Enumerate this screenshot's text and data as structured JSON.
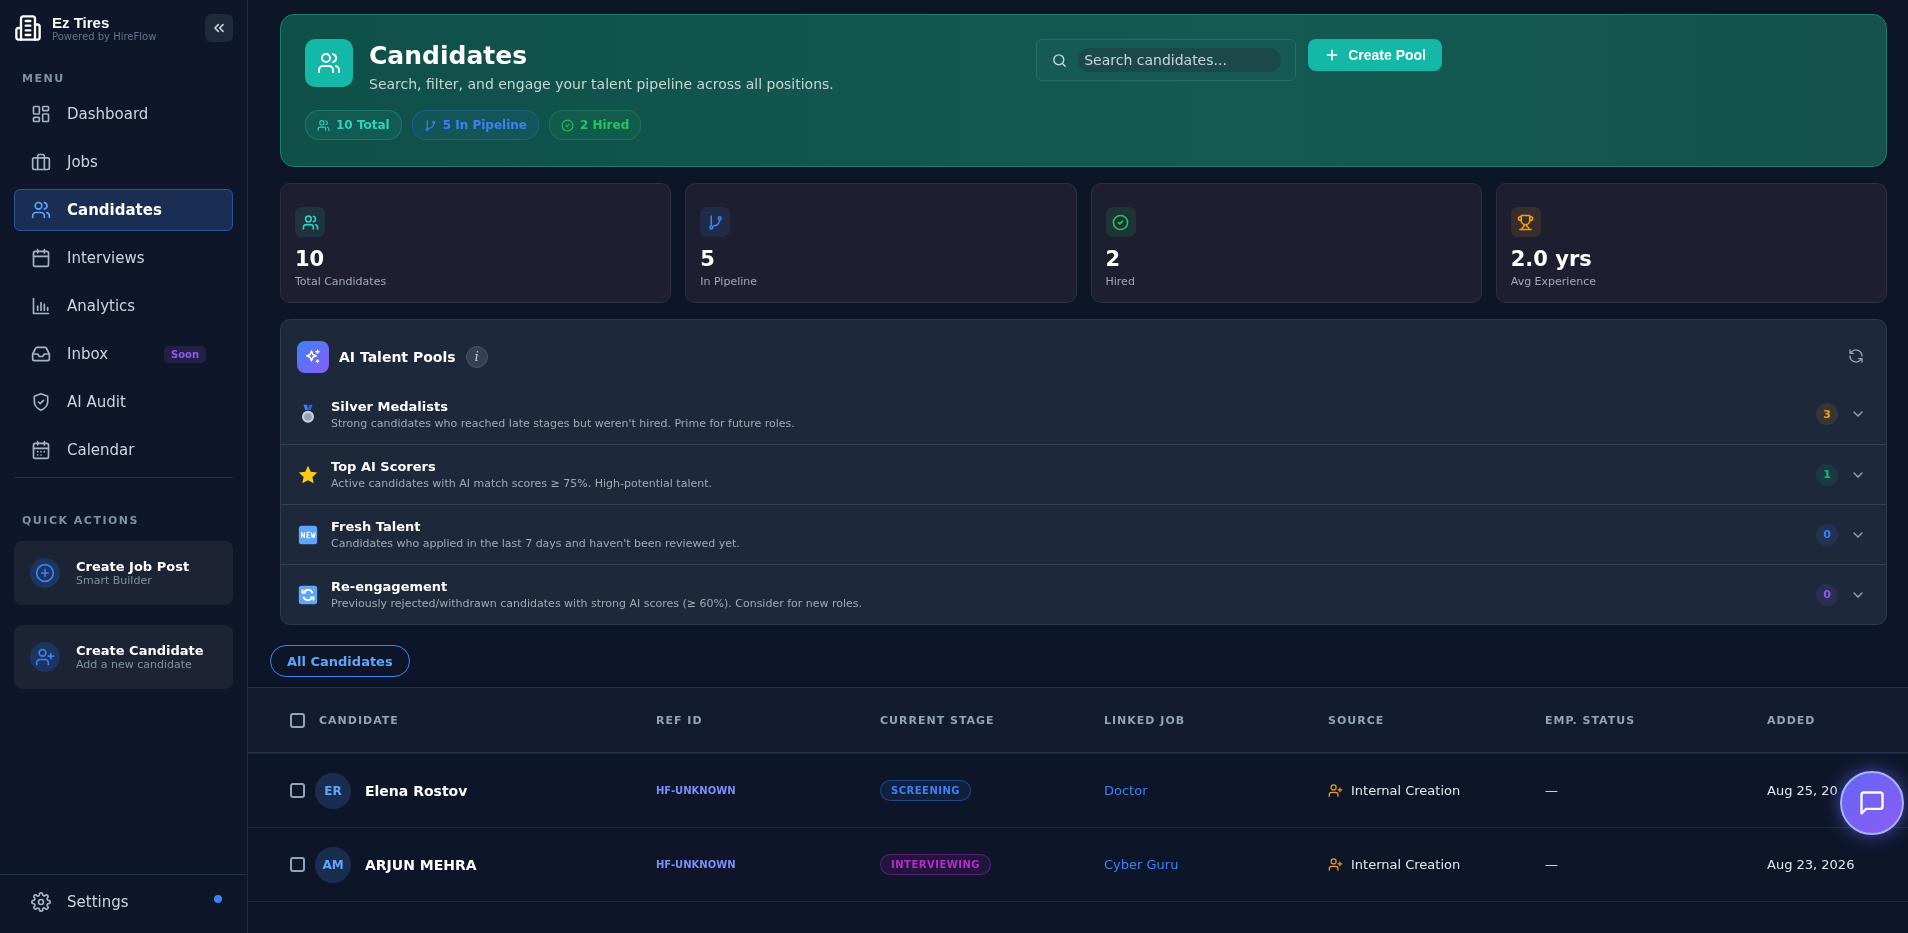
{
  "brand": {
    "name": "Ez Tires",
    "tagline": "Powered by HireFlow"
  },
  "menu": {
    "heading": "MENU",
    "items": [
      {
        "label": "Dashboard",
        "selected": false
      },
      {
        "label": "Jobs",
        "selected": false
      },
      {
        "label": "Candidates",
        "selected": true
      },
      {
        "label": "Interviews",
        "selected": false
      },
      {
        "label": "Analytics",
        "selected": false
      },
      {
        "label": "Inbox",
        "selected": false,
        "badge": "Soon"
      },
      {
        "label": "AI Audit",
        "selected": false
      },
      {
        "label": "Calendar",
        "selected": false
      }
    ]
  },
  "quick_actions": {
    "heading": "QUICK ACTIONS",
    "items": [
      {
        "title": "Create Job Post",
        "subtitle": "Smart Builder"
      },
      {
        "title": "Create Candidate",
        "subtitle": "Add a new candidate"
      }
    ]
  },
  "settings": {
    "label": "Settings",
    "notification": true
  },
  "header": {
    "title": "Candidates",
    "subtitle": "Search, filter, and engage your talent pipeline across all positions.",
    "search": {
      "placeholder": "Search candidates..."
    },
    "button": "Create Pool",
    "chips": [
      {
        "label": "10 Total",
        "color": "#2dd4bf"
      },
      {
        "label": "5 In Pipeline",
        "color": "#3b82f6"
      },
      {
        "label": "2 Hired",
        "color": "#22c55e"
      }
    ]
  },
  "stats": [
    {
      "value": "10",
      "label": "Total Candidates",
      "color": "#2dd4bf"
    },
    {
      "value": "5",
      "label": "In Pipeline",
      "color": "#3b82f6"
    },
    {
      "value": "2",
      "label": "Hired",
      "color": "#22c55e"
    },
    {
      "value": "2.0 yrs",
      "label": "Avg Experience",
      "color": "#f59e0b"
    }
  ],
  "talent_pools": {
    "title": "AI Talent Pools",
    "info": "i",
    "pools": [
      {
        "name": "Silver Medalists",
        "description": "Strong candidates who reached late stages but weren't hired. Prime for future roles.",
        "count": "3",
        "color": "#f59e0b"
      },
      {
        "name": "Top AI Scorers",
        "description": "Active candidates with AI match scores ≥ 75%. High-potential talent.",
        "count": "1",
        "color": "#10b981"
      },
      {
        "name": "Fresh Talent",
        "description": "Candidates who applied in the last 7 days and haven't been reviewed yet.",
        "count": "0",
        "color": "#3b82f6"
      },
      {
        "name": "Re-engagement",
        "description": "Previously rejected/withdrawn candidates with strong AI scores (≥ 60%). Consider for new roles.",
        "count": "0",
        "color": "#8b5cf6"
      }
    ]
  },
  "filter_tab": {
    "label": "All Candidates",
    "selected": true
  },
  "table": {
    "all_checked": false,
    "columns": [
      "CANDIDATE",
      "REF ID",
      "CURRENT STAGE",
      "LINKED JOB",
      "SOURCE",
      "EMP. STATUS",
      "ADDED"
    ],
    "rows": [
      {
        "checked": false,
        "initials": "ER",
        "name": "Elena Rostov",
        "ref": "HF-UNKNOWN",
        "stage": "SCREENING",
        "color": "#3b82f6",
        "job": "Doctor",
        "source": "Internal Creation",
        "emp_status": "—",
        "added": "Aug 25, 20"
      },
      {
        "checked": false,
        "initials": "AM",
        "name": "ARJUN MEHRA",
        "ref": "HF-UNKNOWN",
        "stage": "INTERVIEWING",
        "color": "#c026d3",
        "job": "Cyber Guru",
        "source": "Internal Creation",
        "emp_status": "—",
        "added": "Aug 23, 2026"
      }
    ]
  }
}
